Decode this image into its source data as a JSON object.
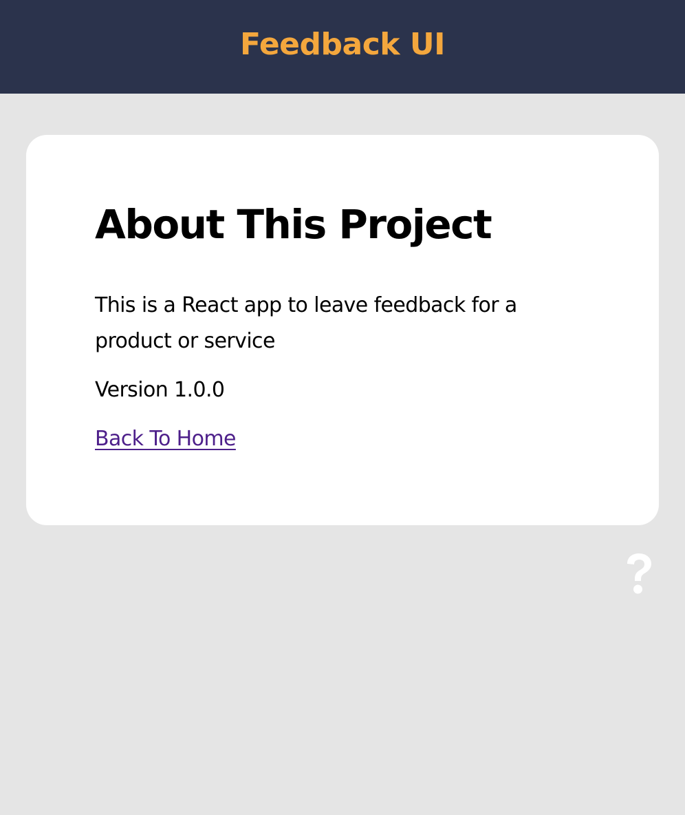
{
  "header": {
    "title": "Feedback UI",
    "title_color": "#f4a73d",
    "background": "#2b334c"
  },
  "about_card": {
    "heading": "About This Project",
    "description": "This is a React app to leave feedback for a product or service",
    "version": "Version 1.0.0",
    "back_link": "Back To Home",
    "link_color": "#4d1f8a"
  },
  "about_icon": {
    "icon": "question-icon",
    "color": "#ffffff"
  }
}
